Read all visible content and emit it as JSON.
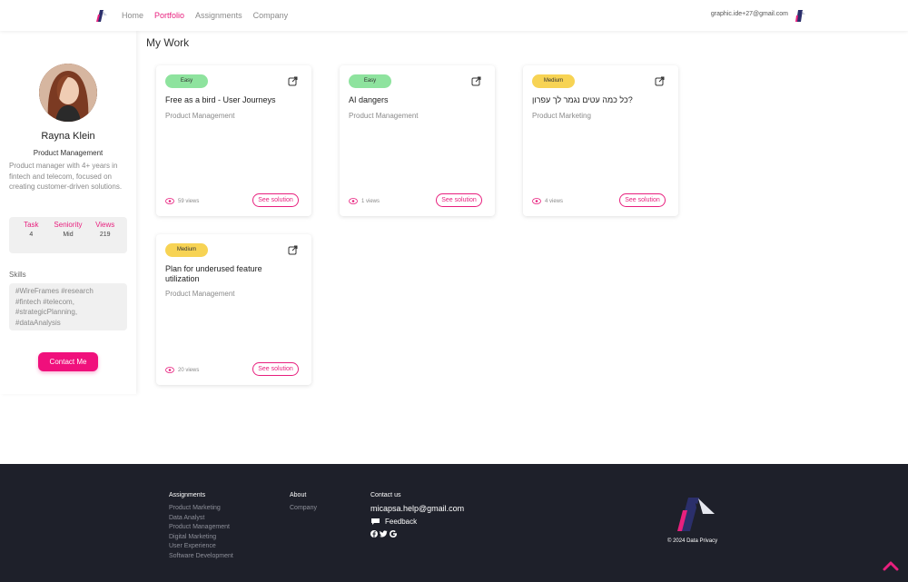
{
  "nav": {
    "items": [
      {
        "label": "Home",
        "active": false
      },
      {
        "label": "Portfolio",
        "active": true
      },
      {
        "label": "Assignments",
        "active": false
      },
      {
        "label": "Company",
        "active": false
      }
    ],
    "user_email": "graphic.ide+27@gmail.com"
  },
  "profile": {
    "name": "Rayna Klein",
    "role": "Product Management",
    "bio": "Product manager with 4+ years in fintech and telecom, focused on creating customer-driven solutions.",
    "stats": {
      "task_label": "Task",
      "task_value": "4",
      "seniority_label": "Seniority",
      "seniority_value": "Mid",
      "views_label": "Views",
      "views_value": "219"
    },
    "skills_title": "Skills",
    "skills": "#WireFrames #research #fintech #telecom, #strategicPlanning, #dataAnalysis",
    "contact_label": "Contact Me"
  },
  "main": {
    "title": "My Work",
    "cards": [
      {
        "badge": "Easy",
        "level": "easy",
        "title": "Free as a bird - User Journeys",
        "category": "Product Management",
        "views": "59 views",
        "cta": "See solution"
      },
      {
        "badge": "Easy",
        "level": "easy",
        "title": "AI dangers",
        "category": "Product Management",
        "views": "1 views",
        "cta": "See solution"
      },
      {
        "badge": "Medium",
        "level": "medium",
        "title": "?כל כמה עטים נגמר לך עפרון",
        "category": "Product Marketing",
        "views": "4 views",
        "cta": "See solution"
      },
      {
        "badge": "Medium",
        "level": "medium",
        "title": "Plan for underused feature utilization",
        "category": "Product Management",
        "views": "20 views",
        "cta": "See solution"
      }
    ]
  },
  "footer": {
    "assignments": {
      "head": "Assignments",
      "links": [
        "Product Marketing",
        "Data Analyst",
        "Product Management",
        "Digital Marketing",
        "User Experience",
        "Software Development"
      ]
    },
    "about": {
      "head": "About",
      "links": [
        "Company"
      ]
    },
    "contact": {
      "head": "Contact us",
      "email": "micapsa.help@gmail.com",
      "feedback": "Feedback"
    },
    "copyright": "© 2024 Data Privacy"
  },
  "colors": {
    "accent": "#e8207e",
    "easy": "#8ee39e",
    "medium": "#f7d354",
    "footer_bg": "#1e202a"
  },
  "icons": [
    "logo-icon",
    "share-icon",
    "eye-icon",
    "feedback-icon",
    "facebook-icon",
    "twitter-icon",
    "google-icon",
    "scroll-top-icon"
  ]
}
